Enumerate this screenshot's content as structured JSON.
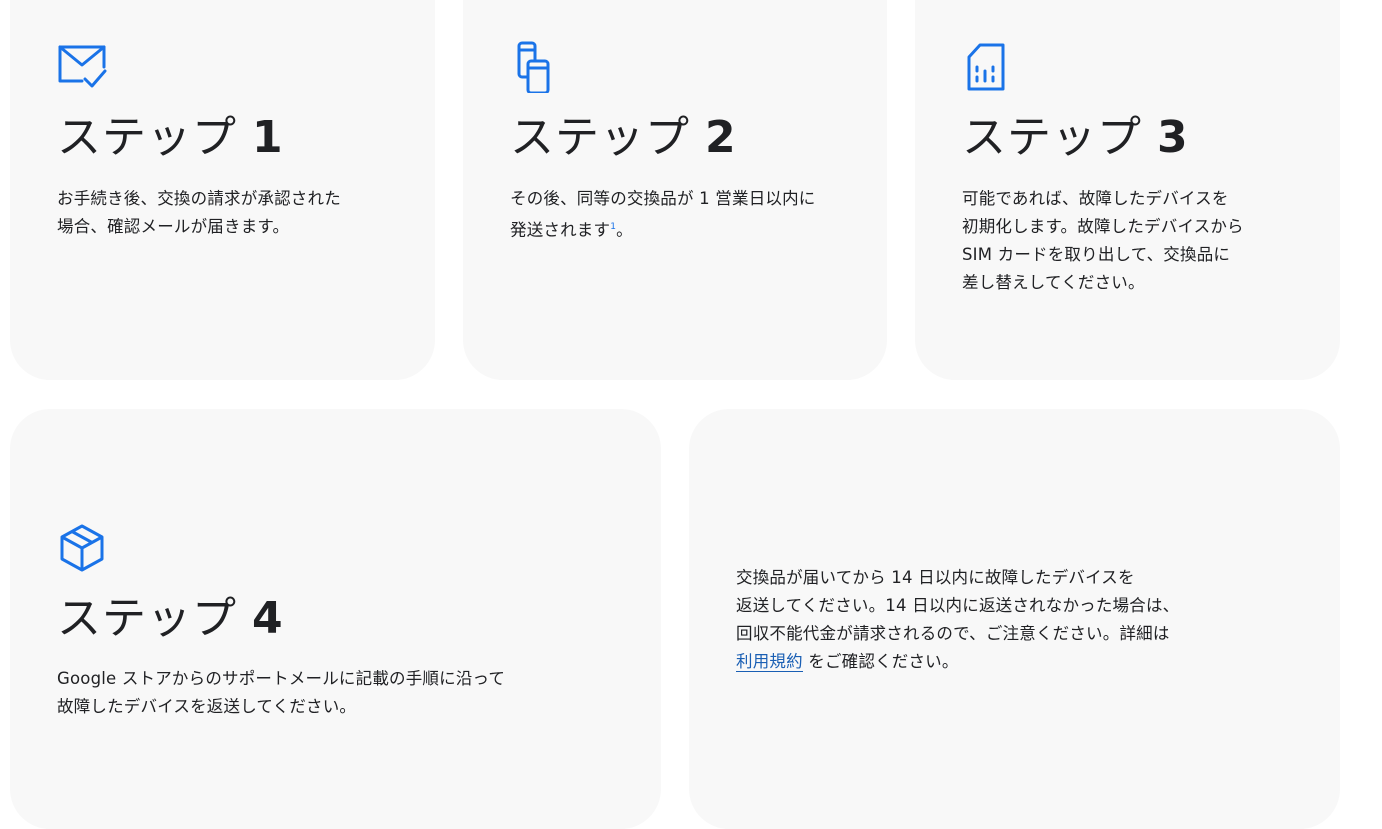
{
  "accent_color": "#1a73e8",
  "steps": [
    {
      "icon": "mail-check-icon",
      "label": "ステップ",
      "number": "1",
      "lines": [
        "お手続き後、交換の請求が承認された",
        "場合、確認メールが届きます。"
      ]
    },
    {
      "icon": "devices-icon",
      "label": "ステップ",
      "number": "2",
      "line1": "その後、同等の交換品が 1 営業日以内に",
      "line2_pre": "発送されます",
      "footnote": "1",
      "line2_post": "。"
    },
    {
      "icon": "sim-card-icon",
      "label": "ステップ",
      "number": "3",
      "lines": [
        "可能であれば、故障したデバイスを",
        "初期化します。故障したデバイスから",
        "SIM カードを取り出して、交換品に",
        "差し替えしてください。"
      ]
    },
    {
      "icon": "package-icon",
      "label": "ステップ",
      "number": "4",
      "lines": [
        "Google ストアからのサポートメールに記載の手順に沿って",
        "故障したデバイスを返送してください。"
      ]
    }
  ],
  "notice": {
    "lines": [
      "交換品が届いてから 14 日以内に故障したデバイスを",
      "返送してください。14 日以内に返送されなかった場合は、",
      "回収不能代金が請求されるので、ご注意ください。詳細は"
    ],
    "link_text": "利用規約",
    "line_end": "をご確認ください。"
  }
}
